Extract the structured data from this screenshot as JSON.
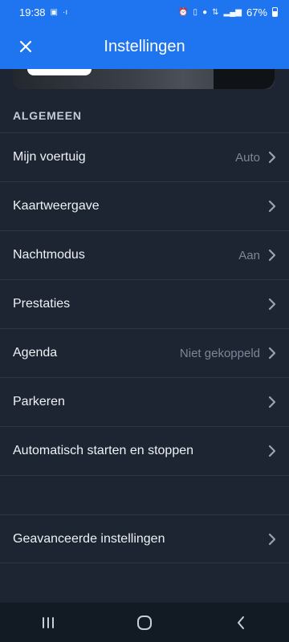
{
  "status_bar": {
    "time": "19:38",
    "battery_percent": "67%",
    "icons": [
      "notification-icon",
      "signal-dot-icon",
      "alarm-icon",
      "vibrate-icon",
      "location-icon",
      "network-4g-icon",
      "signal-bars-icon",
      "battery-icon"
    ]
  },
  "app_bar": {
    "title": "Instellingen",
    "close_icon": "close-icon"
  },
  "section": {
    "header": "ALGEMEEN"
  },
  "settings": [
    {
      "label": "Mijn voertuig",
      "value": "Auto"
    },
    {
      "label": "Kaartweergave",
      "value": ""
    },
    {
      "label": "Nachtmodus",
      "value": "Aan"
    },
    {
      "label": "Prestaties",
      "value": ""
    },
    {
      "label": "Agenda",
      "value": "Niet gekoppeld"
    },
    {
      "label": "Parkeren",
      "value": ""
    },
    {
      "label": "Automatisch starten en stoppen",
      "value": ""
    }
  ],
  "advanced": {
    "label": "Geavanceerde instellingen"
  },
  "nav_bar": {
    "buttons": [
      "recent-apps-icon",
      "home-icon",
      "back-icon"
    ]
  },
  "colors": {
    "accent": "#1f74f0",
    "background": "#1d2533",
    "divider": "#2d3746",
    "secondary_text": "#7c8696"
  }
}
